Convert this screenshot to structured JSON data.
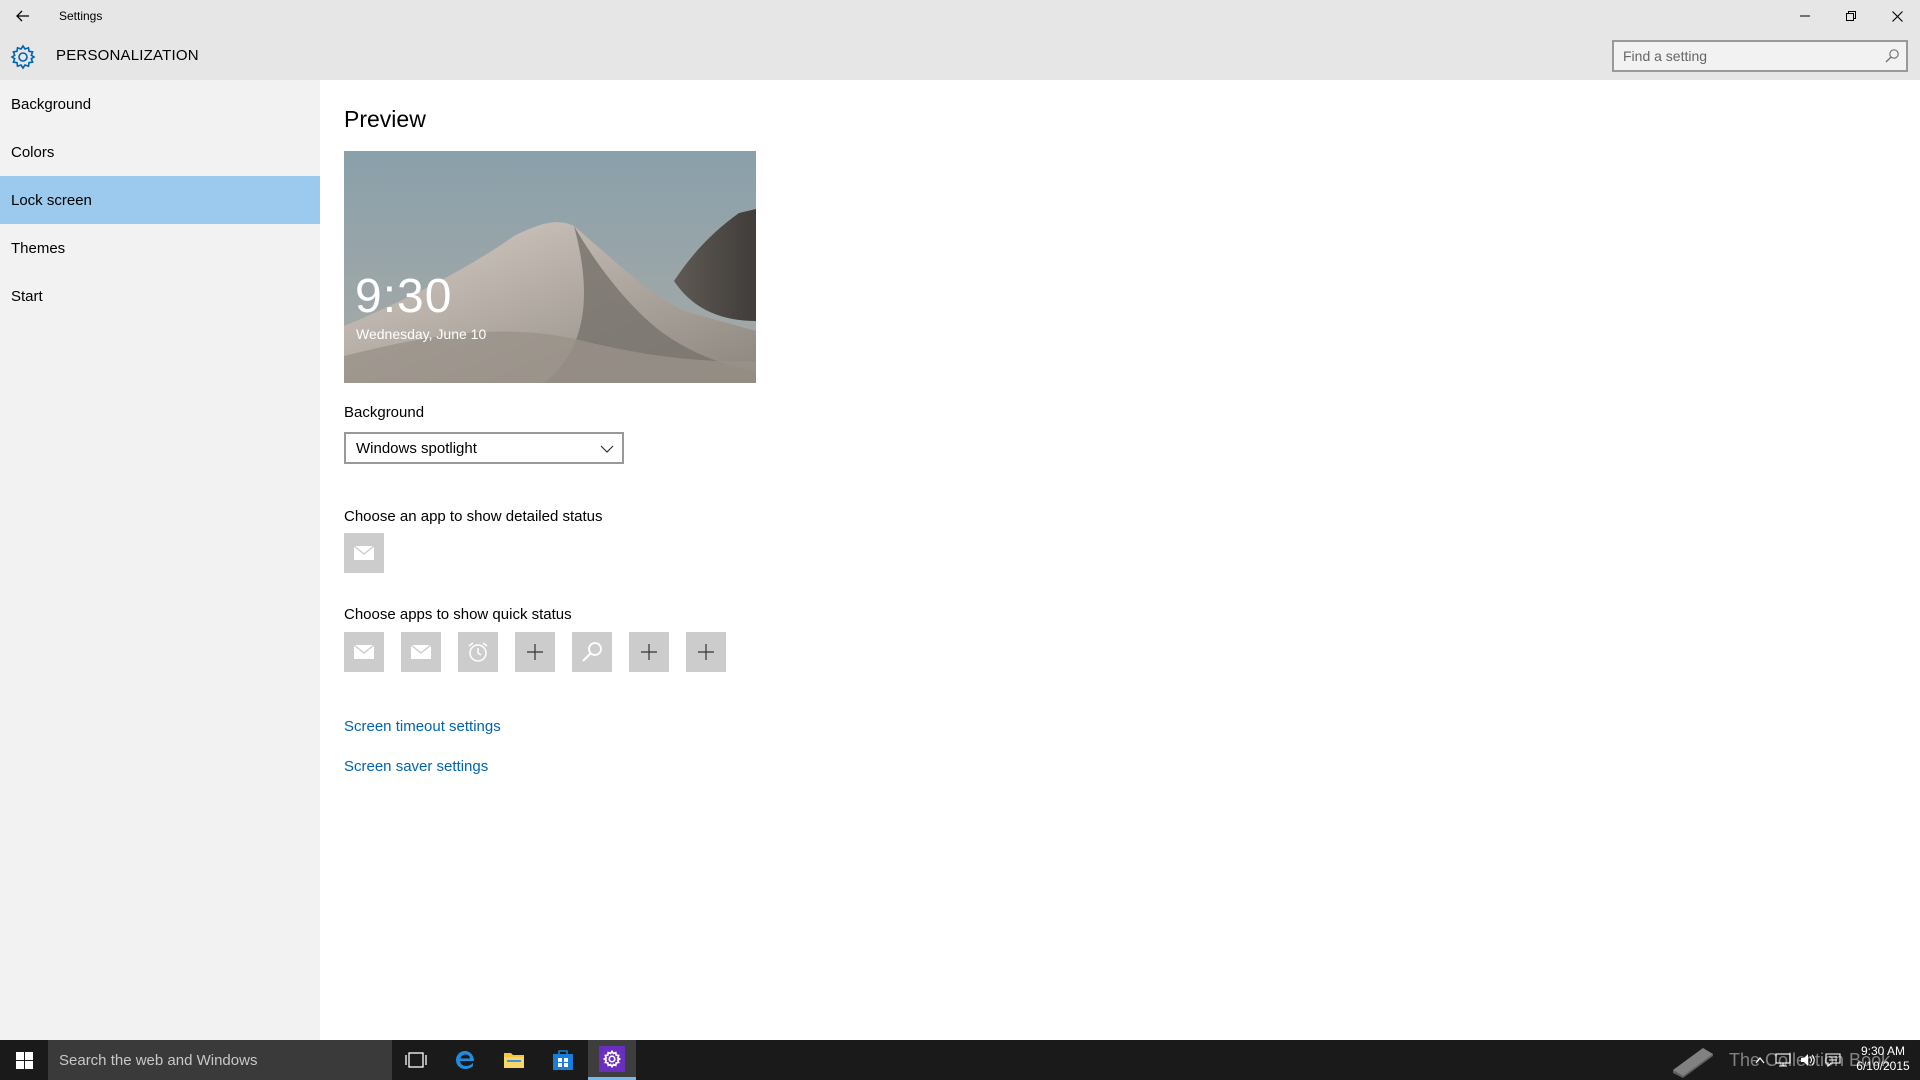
{
  "window": {
    "title": "Settings",
    "controls": {
      "minimize": "minimize-icon",
      "maximize": "restore-icon",
      "close": "close-icon"
    }
  },
  "header": {
    "title": "PERSONALIZATION",
    "search_placeholder": "Find a setting"
  },
  "sidebar": {
    "items": [
      {
        "label": "Background"
      },
      {
        "label": "Colors"
      },
      {
        "label": "Lock screen",
        "selected": true
      },
      {
        "label": "Themes"
      },
      {
        "label": "Start"
      }
    ]
  },
  "main": {
    "preview_title": "Preview",
    "preview": {
      "time": "9:30",
      "date": "Wednesday, June 10"
    },
    "background_label": "Background",
    "background_value": "Windows spotlight",
    "detailed_status_label": "Choose an app to show detailed status",
    "detailed_status_apps": [
      "mail-icon"
    ],
    "quick_status_label": "Choose apps to show quick status",
    "quick_status_apps": [
      "mail-icon",
      "mail-icon",
      "alarm-icon",
      "plus-icon",
      "search-icon",
      "plus-icon",
      "plus-icon"
    ],
    "links": {
      "screen_timeout": "Screen timeout settings",
      "screen_saver": "Screen saver settings"
    }
  },
  "taskbar": {
    "search_placeholder": "Search the web and Windows",
    "watermark": "The Collection Book",
    "clock": {
      "time": "9:30 AM",
      "date": "6/10/2015"
    }
  },
  "colors": {
    "accent": "#0063b1",
    "selected_nav": "#9cc9ee",
    "taskbar": "#1a1a1a"
  }
}
